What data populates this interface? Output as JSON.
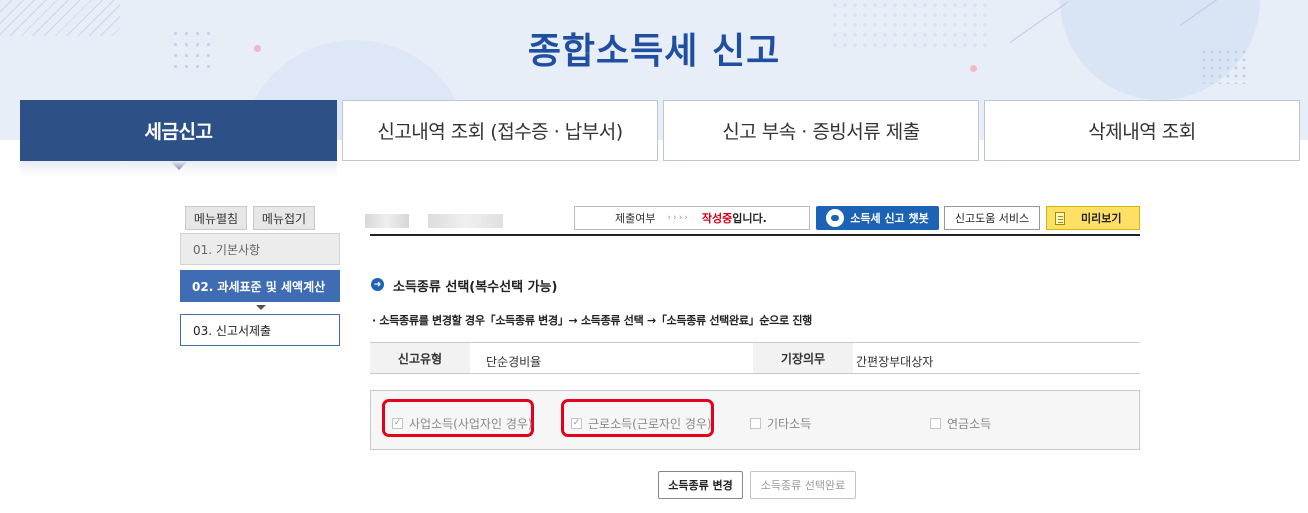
{
  "banner": {
    "title": "종합소득세 신고"
  },
  "tabs": [
    {
      "label": "세금신고",
      "active": true
    },
    {
      "label": "신고내역 조회 (접수증 · 납부서)",
      "active": false
    },
    {
      "label": "신고 부속 · 증빙서류 제출",
      "active": false
    },
    {
      "label": "삭제내역 조회",
      "active": false
    }
  ],
  "left_menu": {
    "expand_label": "메뉴펼침",
    "collapse_label": "메뉴접기",
    "steps": [
      {
        "label": "01.  기본사항",
        "state": "done"
      },
      {
        "label": "02.  과세표준 및 세액계산",
        "state": "current"
      },
      {
        "label": "03.  신고서제출",
        "state": "next"
      }
    ]
  },
  "top_bar": {
    "status_label": "제출여부",
    "status_arrows": "››››",
    "status_highlight": "작성중",
    "status_suffix": "입니다.",
    "chatbot_label": "소득세 신고 챗봇",
    "help_label": "신고도움 서비스",
    "preview_label": "미리보기"
  },
  "section": {
    "title": "소득종류 선택(복수선택 가능)",
    "note": "· 소득종류를 변경할 경우「소득종류 변경」→ 소득종류 선택 →「소득종류 선택완료」순으로 진행"
  },
  "info_table": {
    "type_header": "신고유형",
    "type_value": "단순경비율",
    "duty_header": "기장의무",
    "duty_value": "간편장부대상자"
  },
  "income_types": [
    {
      "label": "사업소득(사업자인 경우)",
      "checked": true,
      "highlighted": true
    },
    {
      "label": "근로소득(근로자인 경우)",
      "checked": true,
      "highlighted": true
    },
    {
      "label": "기타소득",
      "checked": false,
      "highlighted": false
    },
    {
      "label": "연금소득",
      "checked": false,
      "highlighted": false
    }
  ],
  "actions": {
    "change_label": "소득종류 변경",
    "complete_label": "소득종류 선택완료"
  },
  "colors": {
    "primary": "#2d5086",
    "accent_blue": "#1d63b5",
    "status_red": "#d0021b",
    "highlight_red": "#e3001b",
    "preview_yellow": "#ffe066"
  }
}
